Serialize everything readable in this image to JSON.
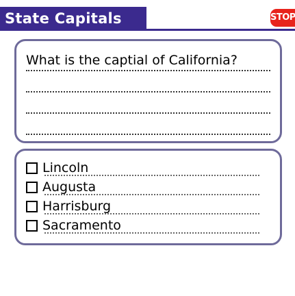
{
  "header": {
    "title": "State Capitals",
    "stop_label": "STOP",
    "accent_color": "#3b2a8e",
    "stop_color": "#e8231c"
  },
  "question": {
    "text": "What is the captial of California?"
  },
  "answers": [
    {
      "label": "Lincoln",
      "checked": false
    },
    {
      "label": "Augusta",
      "checked": false
    },
    {
      "label": "Harrisburg",
      "checked": false
    },
    {
      "label": "Sacramento",
      "checked": false
    }
  ]
}
